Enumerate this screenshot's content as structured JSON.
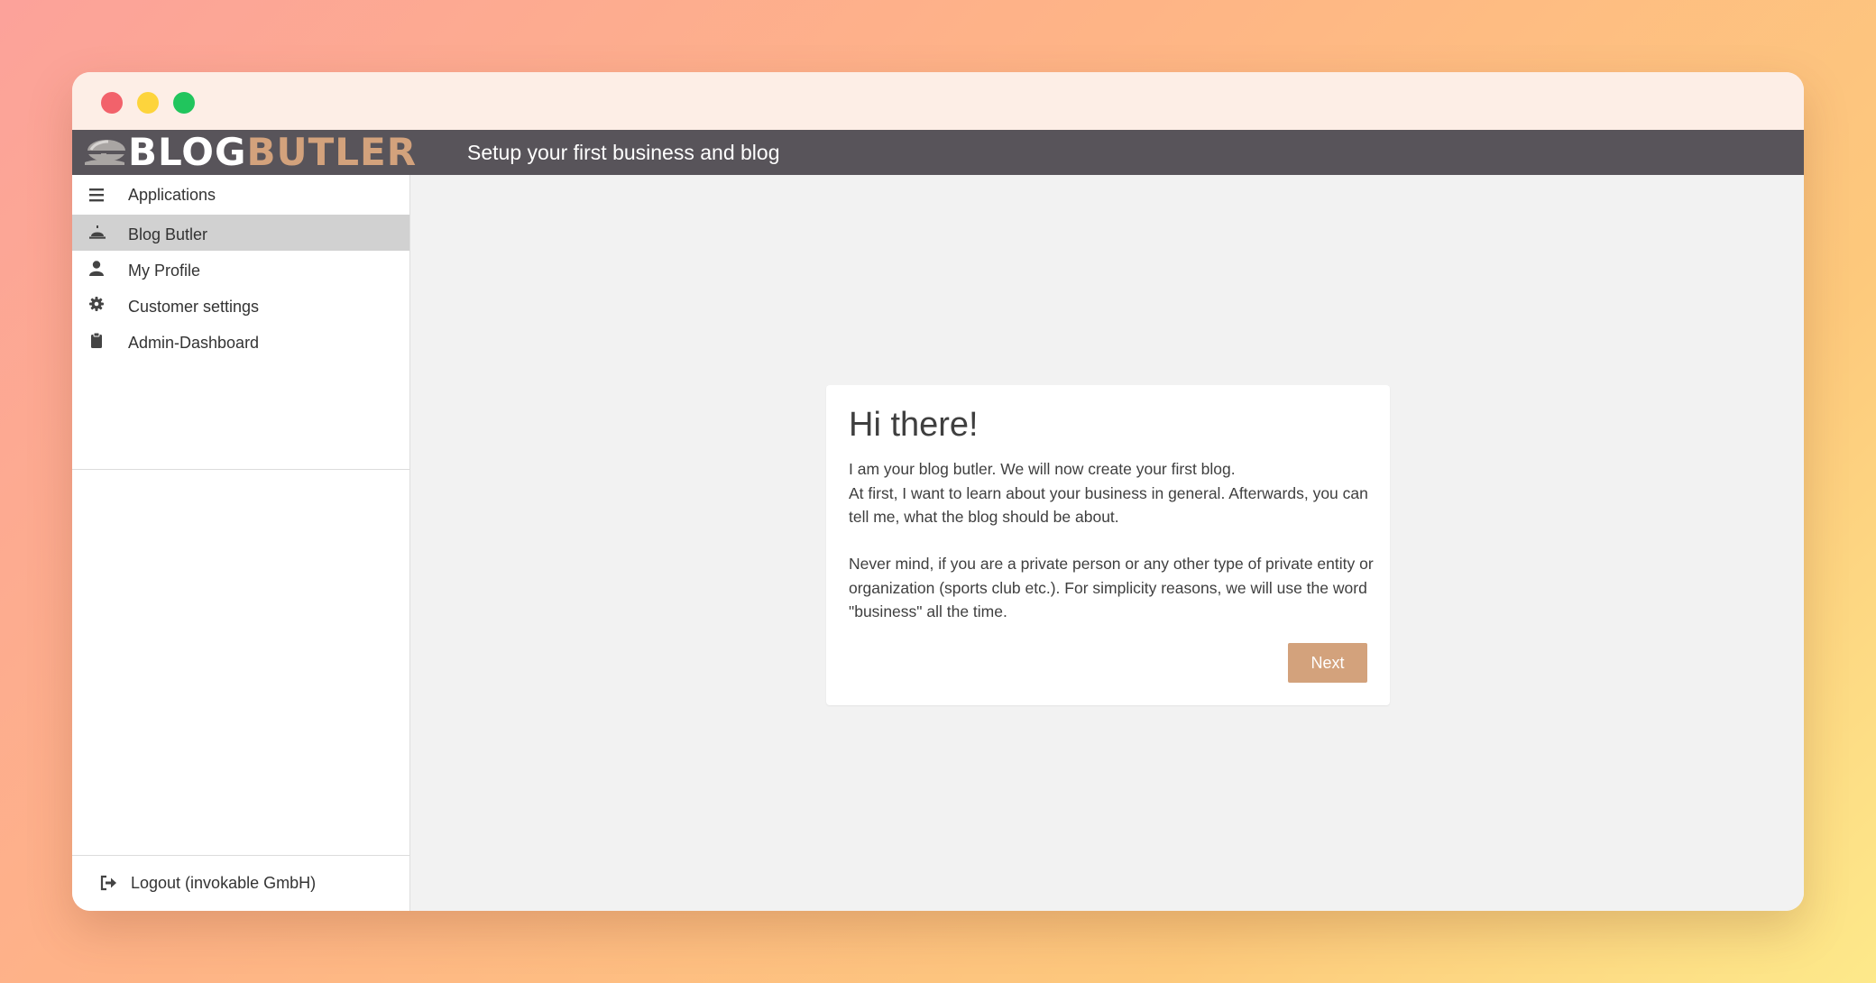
{
  "app": {
    "logo_part1": "BLOG",
    "logo_part2": "BUTLER",
    "page_heading": "Setup your first business and blog"
  },
  "colors": {
    "brand_accent": "#d3a27c",
    "app_bar": "#58545a",
    "active_nav": "#d1d1d1",
    "main_background": "#f2f2f2"
  },
  "sidebar": {
    "menu_label": "Applications",
    "items": [
      {
        "label": "Blog Butler",
        "icon": "service-bell-icon",
        "active": true
      },
      {
        "label": "My Profile",
        "icon": "user-icon",
        "active": false
      },
      {
        "label": "Customer settings",
        "icon": "gear-icon",
        "active": false
      },
      {
        "label": "Admin-Dashboard",
        "icon": "clipboard-icon",
        "active": false
      }
    ],
    "logout_label": "Logout (invokable GmbH)"
  },
  "welcome": {
    "title": "Hi there!",
    "paragraph1": "I am your blog butler. We will now create your first blog.\nAt first, I want to learn about your business in general. Afterwards, you can tell me, what the blog should be about.",
    "paragraph2": "Never mind, if you are a private person or any other type of private entity or organization (sports club etc.). For simplicity reasons, we will use the word \"business\" all the time.",
    "next_label": "Next"
  }
}
